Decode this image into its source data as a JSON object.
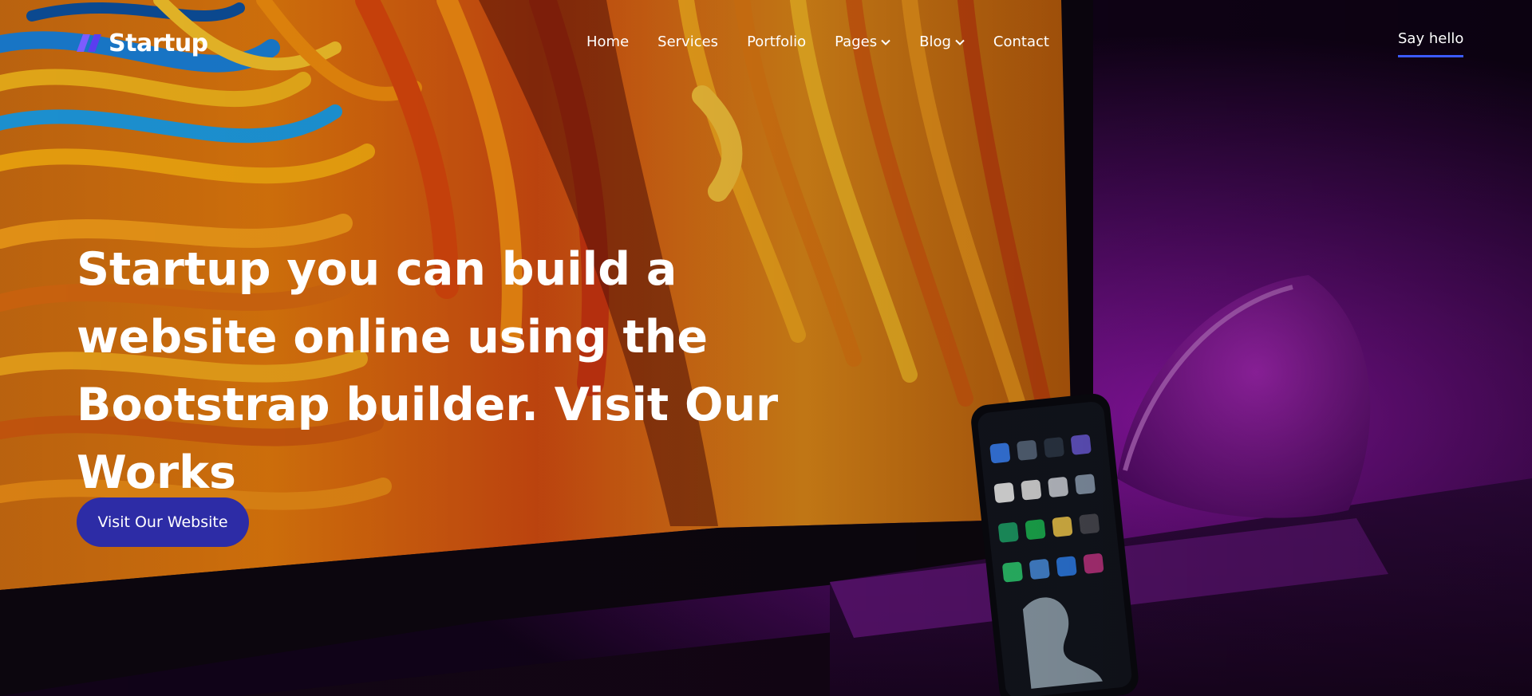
{
  "brand": {
    "name": "Startup",
    "logo_icon": "double-slash-logo-icon",
    "accent_color": "#6d4cff"
  },
  "nav": {
    "items": [
      {
        "label": "Home",
        "has_dropdown": false
      },
      {
        "label": "Services",
        "has_dropdown": false
      },
      {
        "label": "Portfolio",
        "has_dropdown": false
      },
      {
        "label": "Pages",
        "has_dropdown": true
      },
      {
        "label": "Blog",
        "has_dropdown": true
      },
      {
        "label": "Contact",
        "has_dropdown": false
      }
    ],
    "dropdown_icon": "chevron-down-icon"
  },
  "header": {
    "cta_label": "Say hello",
    "cta_underline_color": "#3b5bff"
  },
  "hero": {
    "title": "Startup you can build a website online using the Bootstrap builder. Visit Our Works",
    "button_label": "Visit Our Website",
    "button_color": "#2d2ca6"
  }
}
